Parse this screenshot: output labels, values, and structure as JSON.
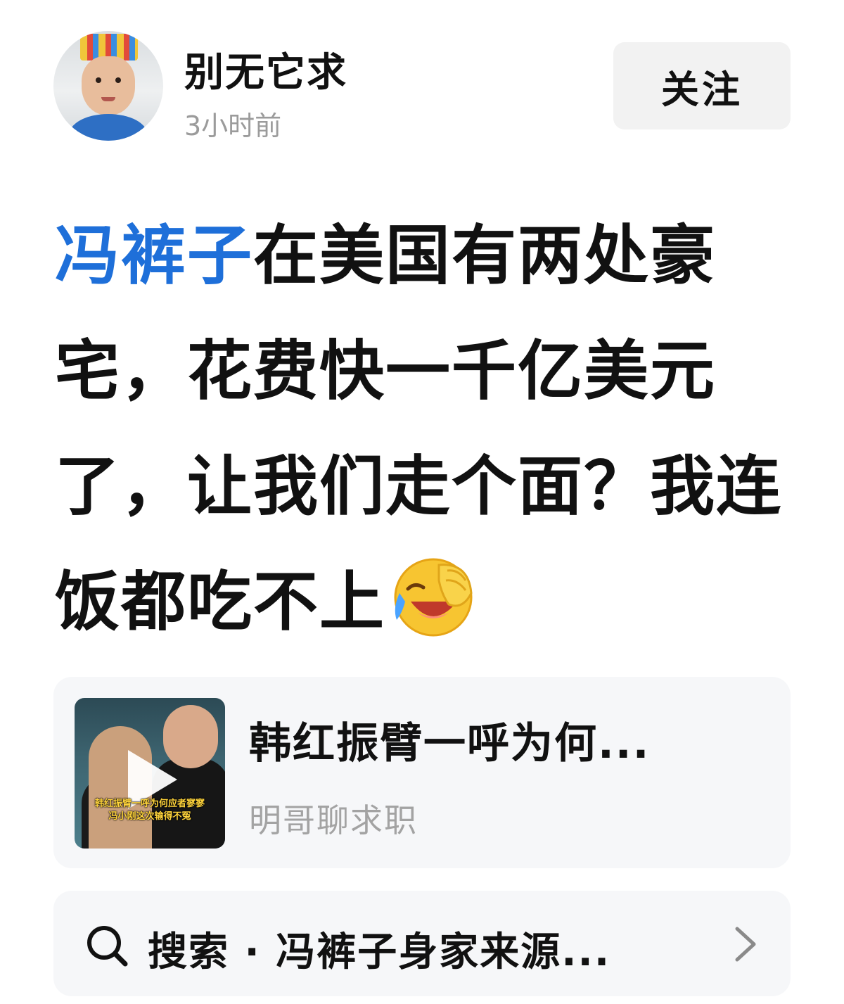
{
  "author": {
    "name": "别无它求",
    "time_ago": "3小时前",
    "avatar_icon": "child-avatar"
  },
  "follow_button": {
    "label": "关注"
  },
  "post": {
    "hashtag": "冯裤子",
    "text": "在美国有两处豪宅，花费快一千亿美元了，让我们走个面？我连饭都吃不上",
    "emoji": "laughing-crying-facepalm-emoji",
    "hashtag_color": "#1e6fd9"
  },
  "linked_video": {
    "title": "韩红振臂一呼为何...",
    "source": "明哥聊求职",
    "thumbnail_caption_line1": "韩红振臂一呼为何应者寥寥",
    "thumbnail_caption_line2": "冯小刚这次输得不冤",
    "play_icon": "play-icon"
  },
  "search": {
    "label": "搜索 · 冯裤子身家来源...",
    "icon": "search-icon",
    "arrow_icon": "chevron-right-icon"
  }
}
